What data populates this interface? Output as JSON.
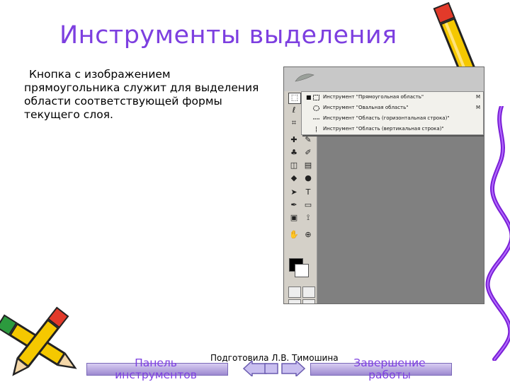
{
  "slide": {
    "title": "Инструменты выделения",
    "body": "Кнопка с изображением прямоугольника служит для выделения области соответствующей формы текущего слоя."
  },
  "tool_menu": {
    "items": [
      {
        "label": "Инструмент \"Прямоугольная область\"",
        "key": "M",
        "selected": true
      },
      {
        "label": "Инструмент \"Овальная область\"",
        "key": "M",
        "selected": false
      },
      {
        "label": "Инструмент \"Область (горизонтальная строка)\"",
        "key": "",
        "selected": false
      },
      {
        "label": "Инструмент \"Область (вертикальная строка)\"",
        "key": "",
        "selected": false
      }
    ]
  },
  "toolbox": {
    "icons": [
      "marquee-tool-icon",
      "move-tool-icon",
      "lasso-tool-icon",
      "magic-wand-tool-icon",
      "crop-tool-icon",
      "slice-tool-icon",
      "healing-brush-icon",
      "brush-tool-icon",
      "clone-stamp-icon",
      "history-brush-icon",
      "eraser-icon",
      "gradient-tool-icon",
      "blur-tool-icon",
      "dodge-tool-icon",
      "path-selection-icon",
      "type-tool-icon",
      "pen-tool-icon",
      "shape-tool-icon",
      "notes-tool-icon",
      "eyedropper-icon",
      "hand-tool-icon",
      "zoom-tool-icon"
    ]
  },
  "footer": {
    "left_label": "Панель инструментов",
    "right_label": "Завершение работы",
    "credit": "Подготовила Л.В. Тимошина"
  },
  "colors": {
    "title": "#7d3fe0",
    "nav_bar": "#b7a9de",
    "panel_gray": "#808080",
    "toolbox": "#d4d0c8"
  }
}
